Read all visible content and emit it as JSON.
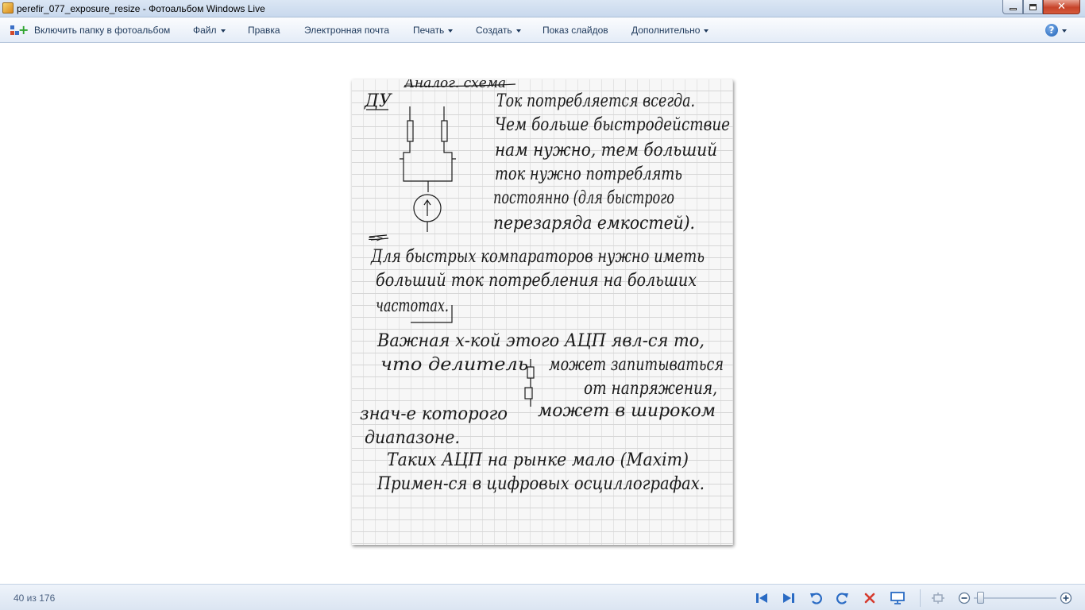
{
  "window": {
    "title": "perefir_077_exposure_resize - Фотоальбом Windows Live",
    "minimize_icon": "minimize-icon",
    "maximize_icon": "maximize-icon",
    "close_icon": "close-icon"
  },
  "menu": {
    "include_folder": "Включить папку в фотоальбом",
    "file": "Файл",
    "fix": "Правка",
    "email": "Электронная почта",
    "print": "Печать",
    "make": "Создать",
    "slideshow": "Показ слайдов",
    "extras": "Дополнительно",
    "help_icon": "help-icon"
  },
  "photo": {
    "alt_label": "perefir_077_exposure_resize",
    "handwritten_lines": [
      "Аналог. схема",
      "ДУ",
      "Ток потребляется всегда.",
      "Чем больше быстродействие",
      "нам нужно, тем больший",
      "ток нужно потреблять",
      "постоянно (для быстрого",
      "перезаряда емкостей).",
      "=>",
      "Для быстрых компараторов нужно иметь",
      "больший ток потребления на больших",
      "частотах.",
      "Важная х-кой этого АЦП явл-ся то,",
      "что делитель",
      "может запитываться",
      "от напряжения,",
      "знач-е которого",
      "может в широком",
      "диапазоне.",
      "Таких АЦП на рынке мало (Maxim)",
      "Примен-ся в цифровых осциллографах."
    ]
  },
  "status": {
    "counter": "40 из 176"
  },
  "controls": {
    "previous_icon": "skip-previous-icon",
    "next_icon": "skip-next-icon",
    "rotate_left_icon": "rotate-counterclockwise-icon",
    "rotate_right_icon": "rotate-clockwise-icon",
    "delete_icon": "delete-icon",
    "slideshow_icon": "slideshow-icon",
    "fit_icon": "fit-to-window-icon",
    "zoom_out_icon": "zoom-out-icon",
    "zoom_in_icon": "zoom-in-icon",
    "zoom_level_fraction": 0.04
  },
  "colors": {
    "menu_text": "#1e395b",
    "nav_blue": "#2a6bc4",
    "delete_red": "#d63a2e",
    "counter_text": "#4a6080"
  }
}
